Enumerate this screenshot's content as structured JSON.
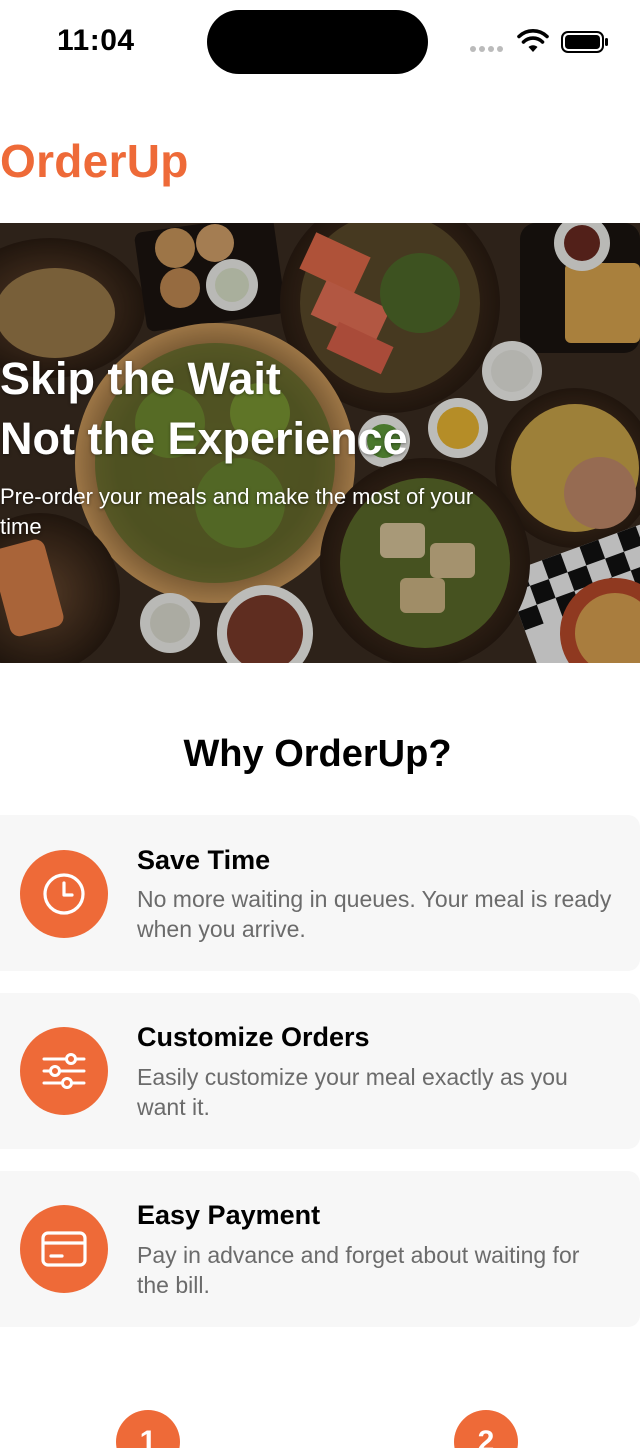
{
  "status_bar": {
    "time": "11:04",
    "icons": [
      "signal-dots-icon",
      "wifi-icon",
      "battery-icon"
    ]
  },
  "app": {
    "title": "OrderUp",
    "accent_color": "#ee6a38"
  },
  "hero": {
    "headline_line1": "Skip the Wait",
    "headline_line2": "Not the Experience",
    "subtitle": "Pre-order your meals and make the most of your time"
  },
  "why": {
    "title": "Why OrderUp?",
    "features": [
      {
        "icon": "clock-icon",
        "title": "Save Time",
        "description": "No more waiting in queues. Your meal is ready when you arrive."
      },
      {
        "icon": "sliders-icon",
        "title": "Customize Orders",
        "description": "Easily customize your meal exactly as you want it."
      },
      {
        "icon": "credit-card-icon",
        "title": "Easy Payment",
        "description": "Pay in advance and forget about waiting for the bill."
      }
    ]
  },
  "steps": [
    "1",
    "2"
  ]
}
